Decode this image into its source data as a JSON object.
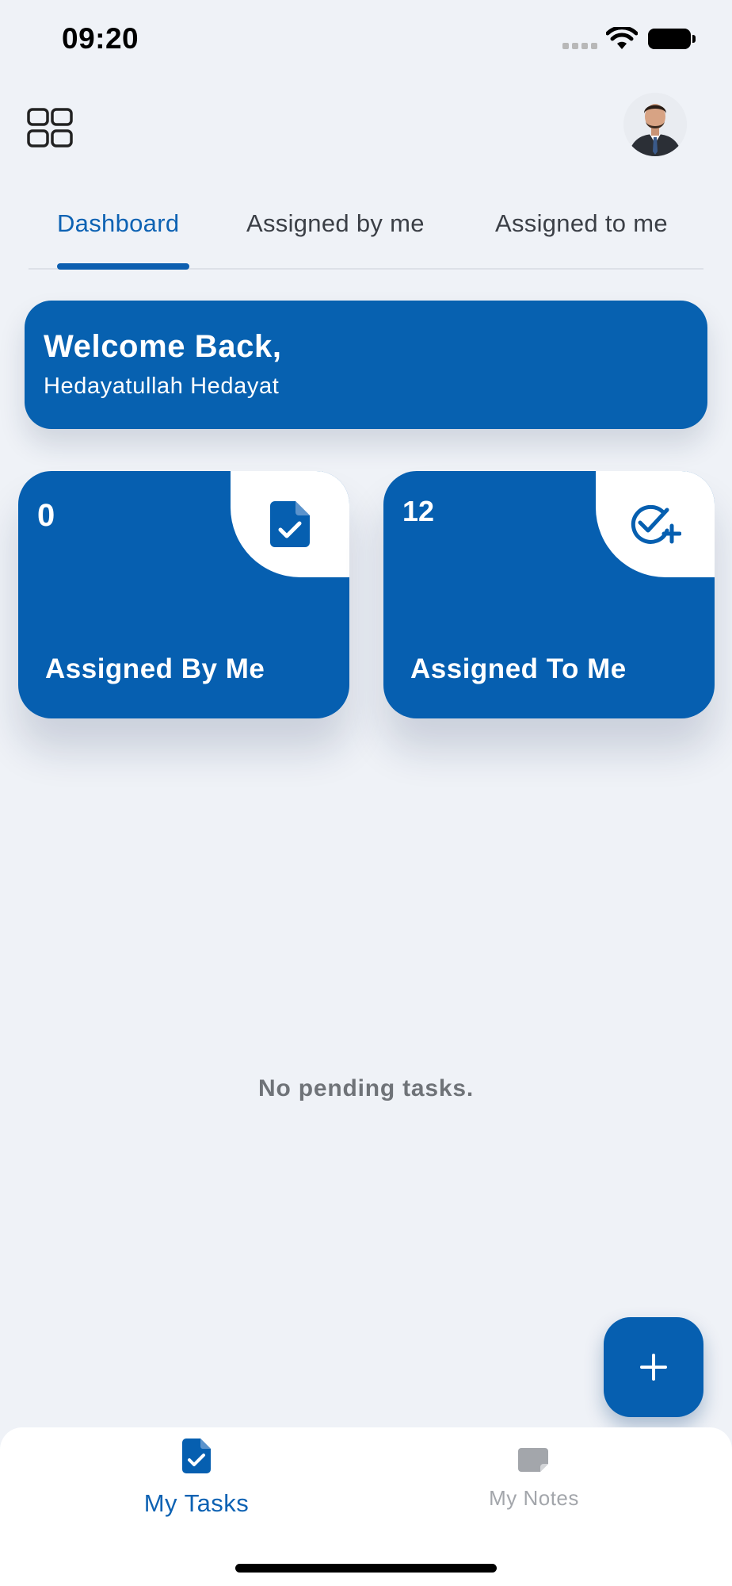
{
  "status_bar": {
    "time": "09:20"
  },
  "header": {},
  "tabs": [
    {
      "label": "Dashboard",
      "active": true
    },
    {
      "label": "Assigned by me",
      "active": false
    },
    {
      "label": "Assigned to me",
      "active": false
    }
  ],
  "welcome": {
    "title": "Welcome Back,",
    "name": "Hedayatullah Hedayat"
  },
  "cards": [
    {
      "count": "0",
      "label": "Assigned By Me",
      "icon": "document-check-icon"
    },
    {
      "count": "12",
      "label": "Assigned To Me",
      "icon": "circle-check-plus-icon"
    }
  ],
  "empty_message": "No pending tasks.",
  "fab": {
    "icon": "plus-icon"
  },
  "bottom_nav": [
    {
      "label": "My Tasks",
      "icon": "document-check-icon",
      "active": true
    },
    {
      "label": "My Notes",
      "icon": "note-icon",
      "active": false
    }
  ],
  "colors": {
    "primary": "#065fb0",
    "background": "#eff2f7",
    "inactive": "#a3a6ab",
    "tab_text": "#3b3f46"
  }
}
